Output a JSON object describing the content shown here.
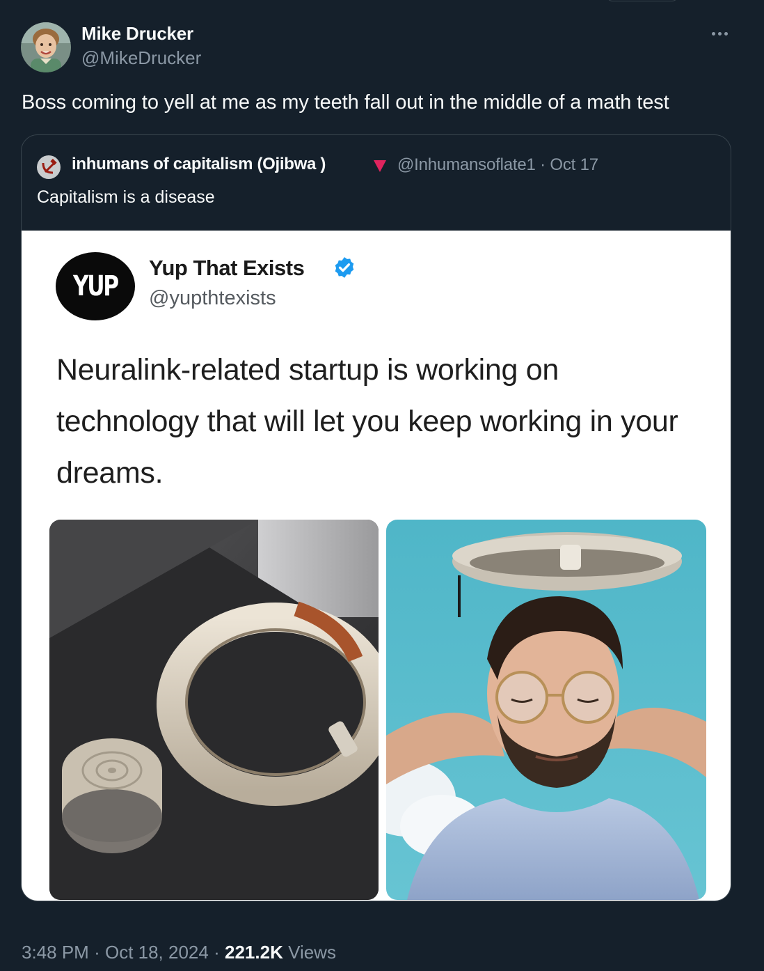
{
  "tweet": {
    "author_name": "Mike Drucker",
    "author_handle": "@MikeDrucker",
    "text": "Boss coming to yell at me as my teeth fall out in the middle of a math test",
    "time": "3:48 PM",
    "date": "Oct 18, 2024",
    "views_count": "221.2K",
    "views_label": "Views",
    "separator": "·"
  },
  "quote": {
    "author_name": "inhumans of capitalism (Ojibwa )",
    "author_handle": "@Inhumansoflate1",
    "separator": "·",
    "date": "Oct 17",
    "text": "Capitalism is a disease",
    "avatar_icon": "hammer-sickle-icon",
    "flag_icon": "red-triangle-icon"
  },
  "embedded_post": {
    "logo_text": "YUP",
    "name": "Yup That Exists",
    "handle": "@yupthtexists",
    "verified_icon": "verified-badge-icon",
    "body": "Neuralink-related startup is working on technology that will let you keep working in your dreams."
  },
  "colors": {
    "background": "#15202b",
    "primary_text": "#f7f9f9",
    "secondary_text": "#8b98a5",
    "border": "#38444d",
    "verified_blue": "#1d9bf0",
    "flag_red": "#e0245e"
  }
}
